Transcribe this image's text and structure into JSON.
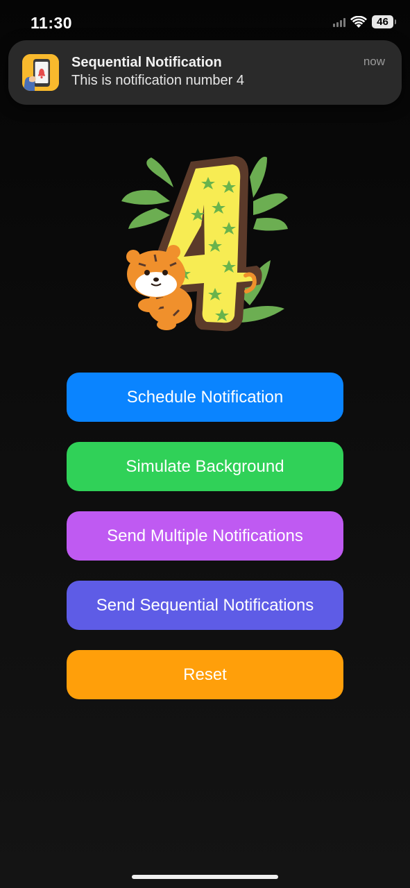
{
  "status_bar": {
    "time": "11:30",
    "battery": "46",
    "icons": [
      "cellular-signal-icon",
      "wifi-icon",
      "battery-icon"
    ]
  },
  "notification": {
    "app_icon": "app-phone-bell-icon",
    "title": "Sequential Notification",
    "body": "This is notification number 4",
    "time": "now"
  },
  "illustration": {
    "icon": "number-four-tiger-illustration"
  },
  "buttons": {
    "schedule": "Schedule Notification",
    "simulate": "Simulate Background",
    "multiple": "Send Multiple Notifications",
    "sequential": "Send Sequential Notifications",
    "reset": "Reset"
  },
  "colors": {
    "schedule": "#0A84FF",
    "simulate": "#30D158",
    "multiple": "#BF5AF2",
    "sequential": "#5E5CE6",
    "reset": "#FF9F0A"
  }
}
